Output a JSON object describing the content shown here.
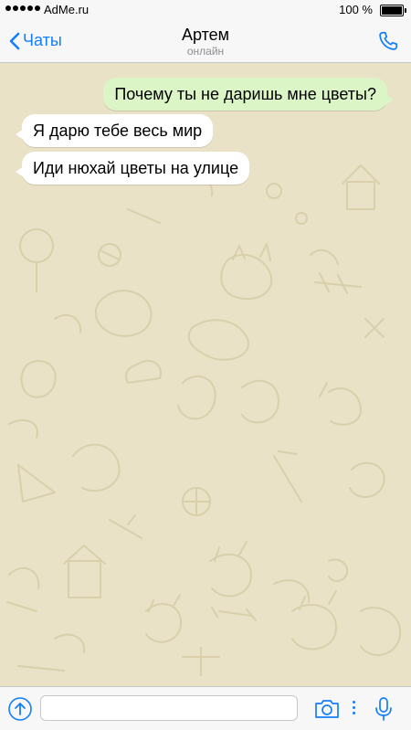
{
  "status_bar": {
    "carrier": "AdMe.ru",
    "battery": "100 %"
  },
  "header": {
    "back_label": "Чаты",
    "title": "Артем",
    "subtitle": "онлайн"
  },
  "messages": [
    {
      "direction": "outgoing",
      "text": "Почему ты не даришь мне цветы?"
    },
    {
      "direction": "incoming",
      "text": "Я дарю тебе весь мир"
    },
    {
      "direction": "incoming",
      "text": "Иди нюхай цветы на улице"
    }
  ],
  "composer": {
    "value": "",
    "placeholder": ""
  },
  "colors": {
    "accent": "#147efb",
    "chat_background": "#e9e2c7",
    "outgoing_bubble": "#dbf5c6",
    "incoming_bubble": "#ffffff"
  },
  "icons": {
    "back": "chevron-left-icon",
    "call": "phone-icon",
    "attach": "arrow-up-circle-icon",
    "camera": "camera-icon",
    "mic": "microphone-icon"
  }
}
